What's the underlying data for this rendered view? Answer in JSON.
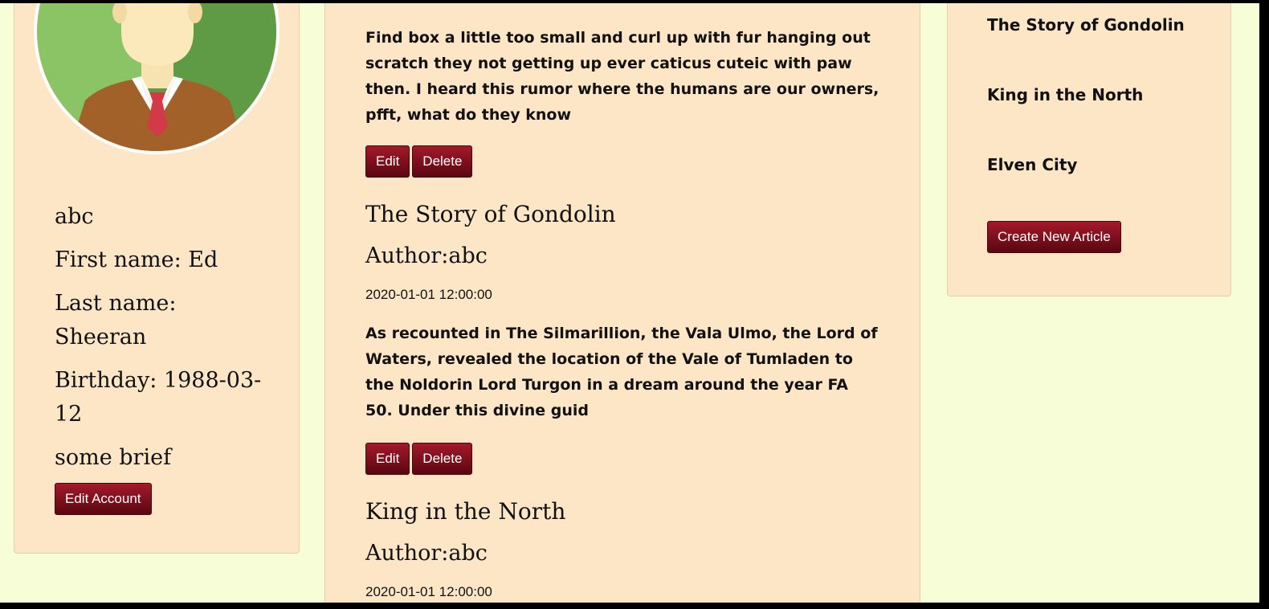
{
  "profile": {
    "username": "abc",
    "first_name": "First name: Ed",
    "last_name": "Last name: Sheeran",
    "birthday": "Birthday: 1988-03-12",
    "brief": "some brief",
    "edit_button": "Edit Account",
    "avatar_icon": "user-avatar-icon"
  },
  "posts": [
    {
      "body": "Find box a little too small and curl up with fur hanging out scratch they not getting up ever caticus cuteic with paw then. I heard this rumor where the humans are our owners, pfft, what do they know",
      "edit_label": "Edit",
      "delete_label": "Delete"
    },
    {
      "title": "The Story of Gondolin",
      "author": "Author:abc",
      "date": "2020-01-01 12:00:00",
      "body": "As recounted in The Silmarillion, the Vala Ulmo, the Lord of Waters, revealed the location of the Vale of Tumladen to the Noldorin Lord Turgon in a dream around the year FA 50. Under this divine guid",
      "edit_label": "Edit",
      "delete_label": "Delete"
    },
    {
      "title": "King in the North",
      "author": "Author:abc",
      "date": "2020-01-01 12:00:00"
    }
  ],
  "sidebar": {
    "articles": [
      "The Story of Gondolin",
      "King in the North",
      "Elven City"
    ],
    "create_button": "Create New Article"
  },
  "colors": {
    "page_background": "#f7fdd7",
    "card_background": "#fde6c6",
    "button_top": "#a3192a",
    "button_bottom": "#5a0711"
  }
}
